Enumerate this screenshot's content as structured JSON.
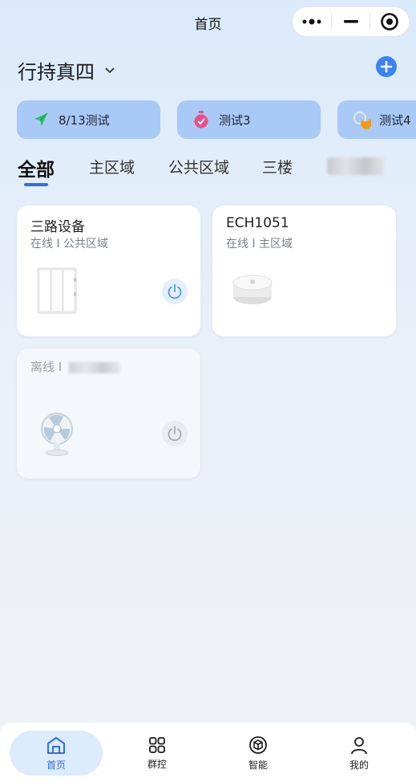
{
  "nav": {
    "title": "首页"
  },
  "capsule": {
    "more_icon": "more-dots-icon",
    "min_icon": "minimize-icon",
    "close_icon": "target-icon"
  },
  "home": {
    "name": "行持真四",
    "accent": "#3b82f6"
  },
  "scenes": [
    {
      "label": "8/13测试",
      "icon": "send-icon"
    },
    {
      "label": "测试3",
      "icon": "timer-icon"
    },
    {
      "label": "测试4",
      "icon": "moon-icon"
    }
  ],
  "tabs": [
    {
      "label": "全部",
      "active": true
    },
    {
      "label": "主区域"
    },
    {
      "label": "公共区域"
    },
    {
      "label": "三楼"
    }
  ],
  "devices": [
    {
      "name": "三路设备",
      "status": "在线 I 公共区域",
      "image": "wall-switch",
      "power_color": "#4a90e2"
    },
    {
      "name": "ECH1051",
      "status": "在线 I 主区域",
      "image": "sensor-puck"
    },
    {
      "name": "",
      "status": "离线 I",
      "image": "desk-fan",
      "power_color": "#a0a4aa"
    }
  ],
  "tabbar": [
    {
      "label": "首页",
      "icon": "home-icon",
      "active": true
    },
    {
      "label": "群控",
      "icon": "grid-icon"
    },
    {
      "label": "智能",
      "icon": "cube-icon"
    },
    {
      "label": "我的",
      "icon": "user-icon"
    }
  ]
}
